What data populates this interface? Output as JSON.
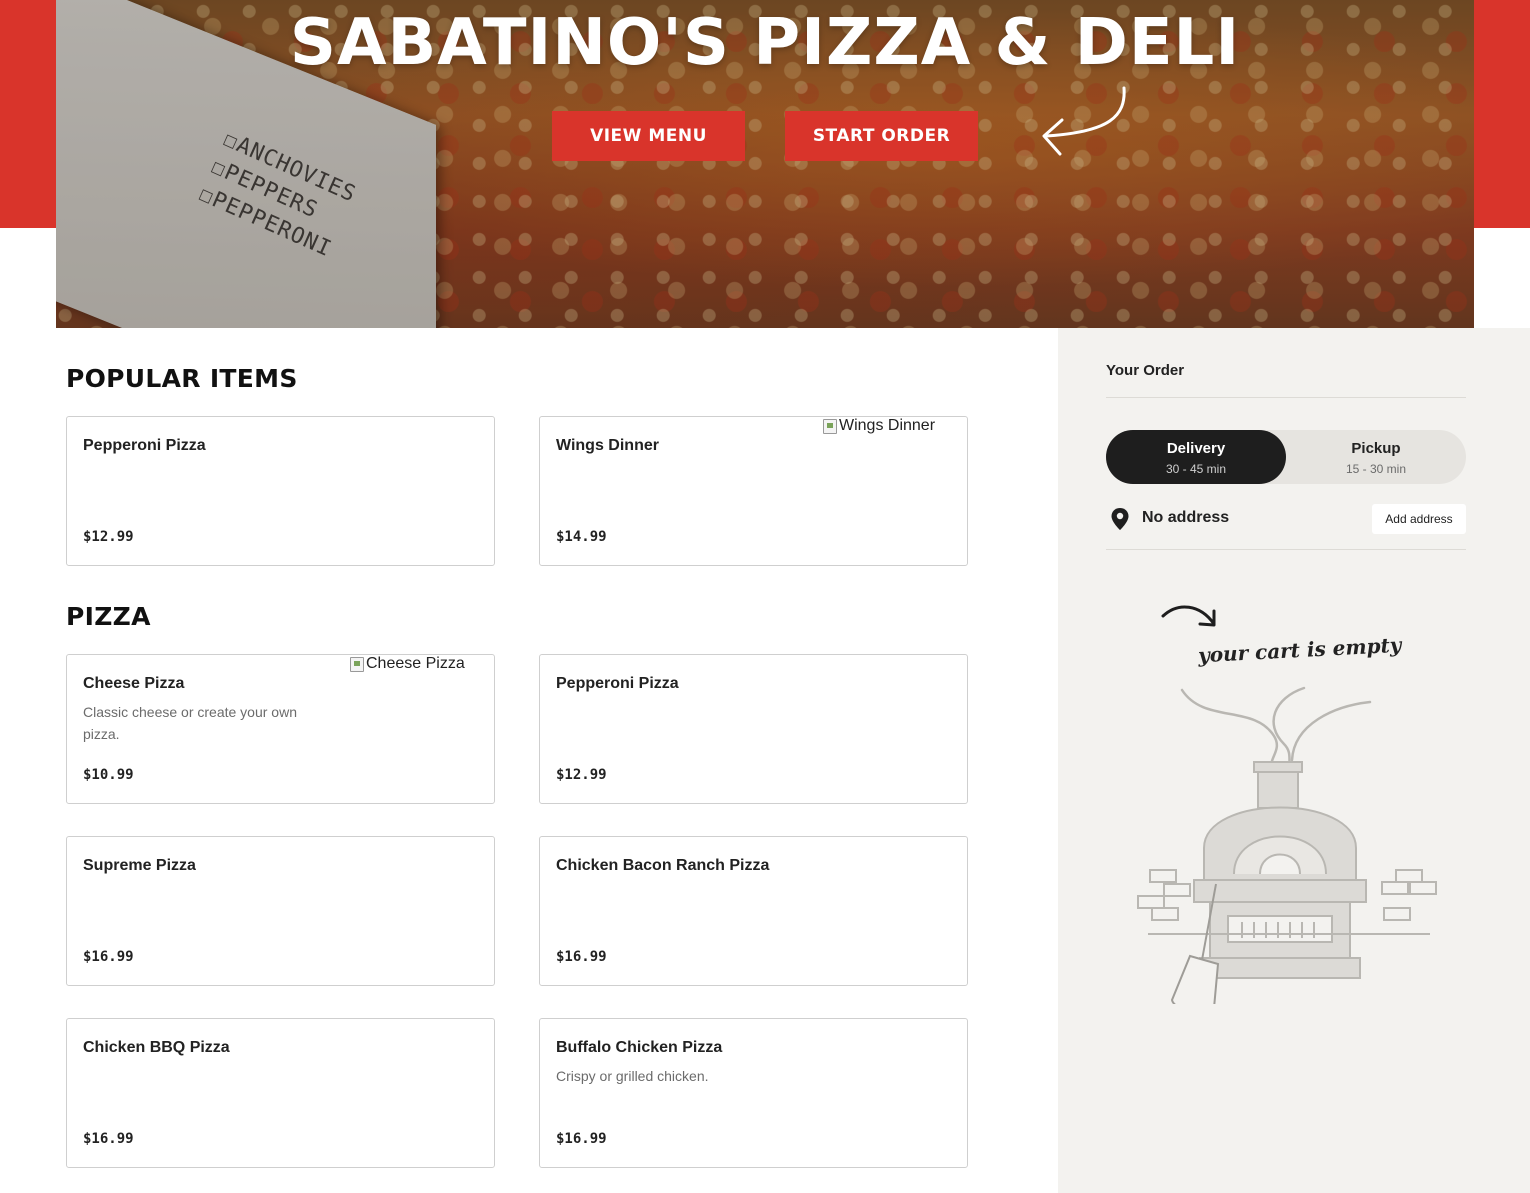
{
  "hero": {
    "title": "SABATINO'S PIZZA & DELI",
    "view_menu_label": "VIEW MENU",
    "start_order_label": "START ORDER",
    "box_labels": [
      "ANCHOVIES",
      "PEPPERS",
      "PEPPERONI"
    ]
  },
  "popular": {
    "title": "POPULAR ITEMS",
    "items": [
      {
        "name": "Pepperoni Pizza",
        "price": "$12.99"
      },
      {
        "name": "Wings Dinner",
        "price": "$14.99",
        "img_alt": "Wings Dinner"
      }
    ]
  },
  "pizza": {
    "title": "PIZZA",
    "items": [
      {
        "name": "Cheese Pizza",
        "desc": "Classic cheese or create your own pizza.",
        "price": "$10.99",
        "img_alt": "Cheese Pizza"
      },
      {
        "name": "Pepperoni Pizza",
        "price": "$12.99"
      },
      {
        "name": "Supreme Pizza",
        "price": "$16.99"
      },
      {
        "name": "Chicken Bacon Ranch Pizza",
        "price": "$16.99"
      },
      {
        "name": "Chicken BBQ Pizza",
        "price": "$16.99"
      },
      {
        "name": "Buffalo Chicken Pizza",
        "desc": "Crispy or grilled chicken.",
        "price": "$16.99"
      }
    ]
  },
  "order": {
    "title": "Your Order",
    "delivery": {
      "label": "Delivery",
      "time": "30 - 45 min",
      "selected": true
    },
    "pickup": {
      "label": "Pickup",
      "time": "15 - 30 min",
      "selected": false
    },
    "address_text": "No address",
    "add_address_label": "Add address",
    "empty_text": "your cart is empty"
  },
  "colors": {
    "brand_red": "#d9342b",
    "sidebar_bg": "#f3f2ef",
    "dark": "#1e1e1e"
  },
  "icons": {
    "pin": "location-pin-icon",
    "arrow": "curved-arrow-icon"
  }
}
